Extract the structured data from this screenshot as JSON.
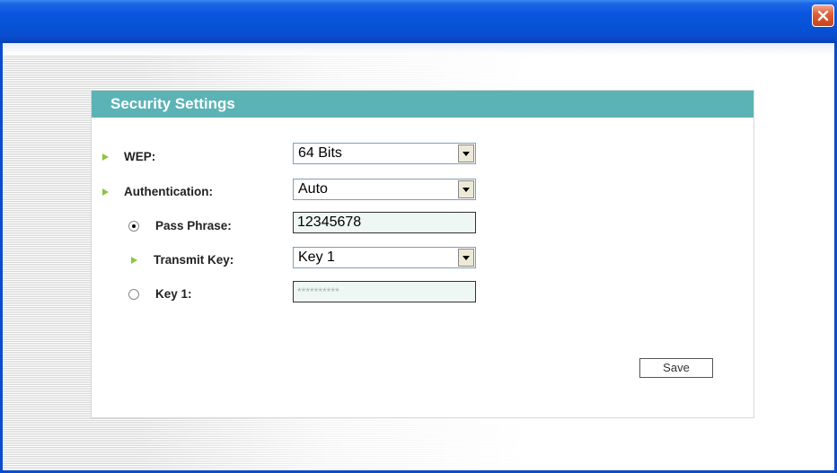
{
  "window": {
    "close_icon": "close-icon",
    "close_color": "#d9532f",
    "titlebar_color": "#0a56df"
  },
  "panel": {
    "title": "Security Settings",
    "header_color": "#5bb3b5",
    "bullet_color": "#8cc63f"
  },
  "fields": {
    "wep": {
      "label": "WEP:",
      "value": "64 Bits"
    },
    "authentication": {
      "label": "Authentication:",
      "value": "Auto"
    },
    "pass_phrase": {
      "label": "Pass Phrase:",
      "value": "12345678",
      "selected": true
    },
    "transmit_key": {
      "label": "Transmit Key:",
      "value": "Key 1"
    },
    "key1": {
      "label": "Key 1:",
      "value": "**********",
      "selected": false
    }
  },
  "actions": {
    "save_label": "Save"
  }
}
